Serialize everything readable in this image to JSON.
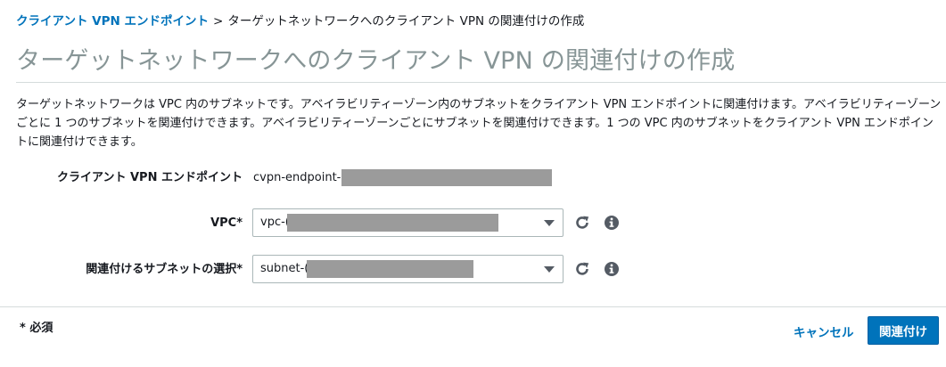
{
  "breadcrumb": {
    "parent": "クライアント VPN エンドポイント",
    "separator": ">",
    "current": "ターゲットネットワークへのクライアント VPN の関連付けの作成"
  },
  "page_title": "ターゲットネットワークへのクライアント VPN の関連付けの作成",
  "description": "ターゲットネットワークは VPC 内のサブネットです。アベイラビリティーゾーン内のサブネットをクライアント VPN エンドポイントに関連付けます。アベイラビリティーゾーンごとに 1 つのサブネットを関連付けできます。アベイラビリティーゾーンごとにサブネットを関連付けできます。1 つの VPC 内のサブネットをクライアント VPN エンドポイントに関連付けできます。",
  "form": {
    "endpoint": {
      "label": "クライアント VPN エンドポイント",
      "value_prefix": "cvpn-endpoint-"
    },
    "vpc": {
      "label": "VPC*",
      "value_prefix": "vpc-("
    },
    "subnet": {
      "label": "関連付けるサブネットの選択*",
      "value_prefix": "subnet-("
    }
  },
  "footer": {
    "required_note": "* 必須",
    "cancel_label": "キャンセル",
    "submit_label": "関連付け"
  },
  "icons": {
    "refresh": "refresh-icon",
    "info": "info-icon"
  },
  "colors": {
    "link": "#0073bb",
    "primary": "#0073bb",
    "title": "#879596",
    "redaction": "#9b9b9b"
  }
}
